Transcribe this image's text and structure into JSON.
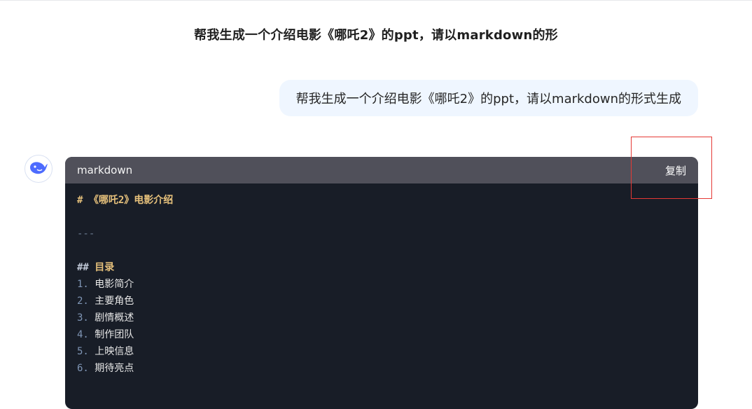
{
  "chat": {
    "title": "帮我生成一个介绍电影《哪吒2》的ppt，请以markdown的形",
    "user_message": "帮我生成一个介绍电影《哪吒2》的ppt，请以markdown的形式生成"
  },
  "assistant": {
    "avatar_icon": "whale-logo-icon",
    "code_block": {
      "language": "markdown",
      "copy_label": "复制",
      "h1_marker": "#",
      "h1_text": "《哪吒2》电影介绍",
      "hr": "---",
      "h2_marker": "##",
      "h2_text": "目录",
      "list": [
        {
          "num": "1.",
          "text": "电影简介"
        },
        {
          "num": "2.",
          "text": "主要角色"
        },
        {
          "num": "3.",
          "text": "剧情概述"
        },
        {
          "num": "4.",
          "text": "制作团队"
        },
        {
          "num": "5.",
          "text": "上映信息"
        },
        {
          "num": "6.",
          "text": "期待亮点"
        }
      ]
    }
  },
  "colors": {
    "accent": "#4d6bfe",
    "code_bg": "#181d27",
    "code_header_bg": "#50505a",
    "user_bubble_bg": "#eff6ff",
    "highlight": "#e53935"
  }
}
